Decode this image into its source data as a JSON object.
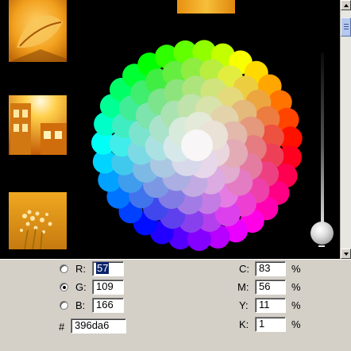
{
  "color_picker": {
    "rgb": {
      "r": {
        "label": "R:",
        "value": "57",
        "selected": false
      },
      "g": {
        "label": "G:",
        "value": "109",
        "selected": true
      },
      "b": {
        "label": "B:",
        "value": "166",
        "selected": false
      }
    },
    "hex": {
      "label": "#",
      "value": "396da6"
    },
    "cmyk": {
      "c": {
        "label": "C:",
        "value": "83",
        "unit": "%"
      },
      "m": {
        "label": "M:",
        "value": "56",
        "unit": "%"
      },
      "y": {
        "label": "Y:",
        "value": "11",
        "unit": "%"
      },
      "k": {
        "label": "K:",
        "value": "1",
        "unit": "%"
      }
    },
    "brightness_level": 0.97
  },
  "colors": {
    "canvas_bg": "#000000",
    "panel_bg": "#d4d0c8",
    "selection": "#0a246a",
    "scrollbar_thumb": "#b6c8ee"
  }
}
